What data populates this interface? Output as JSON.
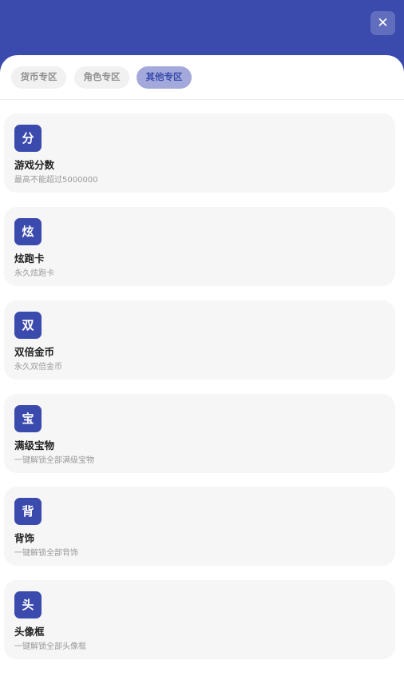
{
  "header": {
    "close_label": "✕"
  },
  "tabs": [
    {
      "label": "货币专区",
      "active": false
    },
    {
      "label": "角色专区",
      "active": false
    },
    {
      "label": "其他专区",
      "active": true
    }
  ],
  "items": [
    {
      "badge": "分",
      "title": "游戏分数",
      "desc": "最高不能超过5000000"
    },
    {
      "badge": "炫",
      "title": "炫跑卡",
      "desc": "永久炫跑卡"
    },
    {
      "badge": "双",
      "title": "双倍金币",
      "desc": "永久双倍金币"
    },
    {
      "badge": "宝",
      "title": "满级宝物",
      "desc": "一键解锁全部满级宝物"
    },
    {
      "badge": "背",
      "title": "背饰",
      "desc": "一键解锁全部背饰"
    },
    {
      "badge": "头",
      "title": "头像框",
      "desc": "一键解锁全部头像框"
    }
  ],
  "colors": {
    "primary": "#3a4aad",
    "tab_active_bg": "#a3aadb",
    "card_bg": "#f6f6f6"
  }
}
